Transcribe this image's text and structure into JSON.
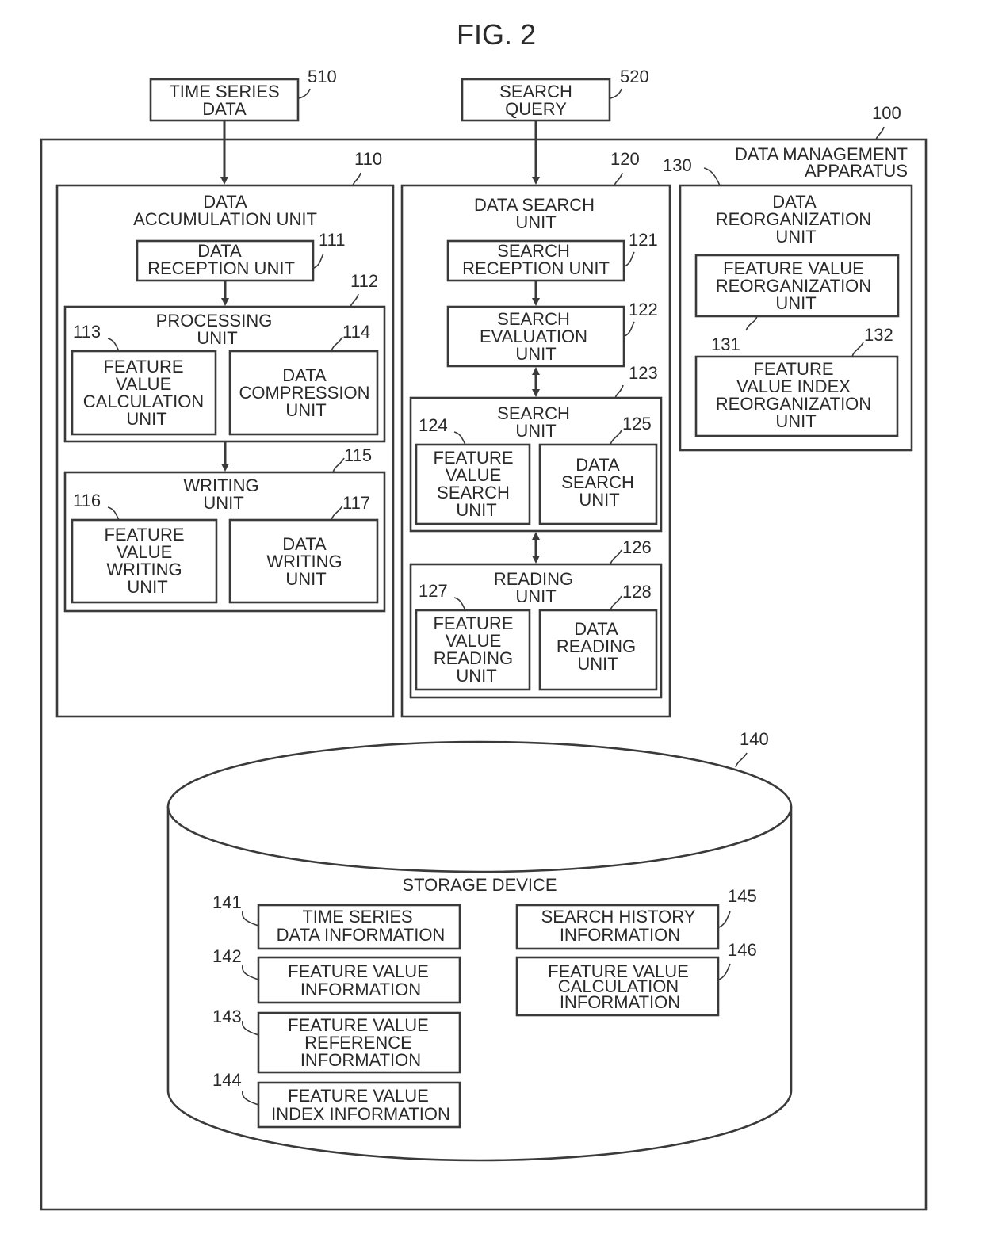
{
  "figure": {
    "title": "FIG. 2"
  },
  "inputs": [
    {
      "ref": "510",
      "lines": [
        "TIME SERIES",
        "DATA"
      ]
    },
    {
      "ref": "520",
      "lines": [
        "SEARCH",
        "QUERY"
      ]
    }
  ],
  "apparatus": {
    "ref": "100",
    "lines": [
      "DATA MANAGEMENT",
      "APPARATUS"
    ]
  },
  "accumulation": {
    "ref": "110",
    "lines": [
      "DATA",
      "ACCUMULATION UNIT"
    ],
    "reception": {
      "ref": "111",
      "lines": [
        "DATA",
        "RECEPTION UNIT"
      ]
    },
    "processing": {
      "ref": "112",
      "lines": [
        "PROCESSING",
        "UNIT"
      ],
      "left": {
        "ref": "113",
        "lines": [
          "FEATURE",
          "VALUE",
          "CALCULATION",
          "UNIT"
        ]
      },
      "right": {
        "ref": "114",
        "lines": [
          "DATA",
          "COMPRESSION",
          "UNIT"
        ]
      }
    },
    "writing": {
      "ref": "115",
      "lines": [
        "WRITING",
        "UNIT"
      ],
      "left": {
        "ref": "116",
        "lines": [
          "FEATURE",
          "VALUE",
          "WRITING",
          "UNIT"
        ]
      },
      "right": {
        "ref": "117",
        "lines": [
          "DATA",
          "WRITING",
          "UNIT"
        ]
      }
    }
  },
  "search": {
    "ref": "120",
    "lines": [
      "DATA SEARCH",
      "UNIT"
    ],
    "reception": {
      "ref": "121",
      "lines": [
        "SEARCH",
        "RECEPTION UNIT"
      ]
    },
    "evaluation": {
      "ref": "122",
      "lines": [
        "SEARCH",
        "EVALUATION",
        "UNIT"
      ]
    },
    "search_unit": {
      "ref": "123",
      "lines": [
        "SEARCH",
        "UNIT"
      ],
      "left": {
        "ref": "124",
        "lines": [
          "FEATURE",
          "VALUE",
          "SEARCH",
          "UNIT"
        ]
      },
      "right": {
        "ref": "125",
        "lines": [
          "DATA",
          "SEARCH",
          "UNIT"
        ]
      }
    },
    "reading": {
      "ref": "126",
      "lines": [
        "READING",
        "UNIT"
      ],
      "left": {
        "ref": "127",
        "lines": [
          "FEATURE",
          "VALUE",
          "READING",
          "UNIT"
        ]
      },
      "right": {
        "ref": "128",
        "lines": [
          "DATA",
          "READING",
          "UNIT"
        ]
      }
    }
  },
  "reorganization": {
    "ref": "130",
    "lines": [
      "DATA",
      "REORGANIZATION",
      "UNIT"
    ],
    "feature": {
      "ref": "131",
      "lines": [
        "FEATURE VALUE",
        "REORGANIZATION",
        "UNIT"
      ]
    },
    "index": {
      "ref": "132",
      "lines": [
        "FEATURE",
        "VALUE INDEX",
        "REORGANIZATION",
        "UNIT"
      ]
    }
  },
  "storage": {
    "ref": "140",
    "label": "STORAGE DEVICE",
    "items": [
      {
        "ref": "141",
        "lines": [
          "TIME SERIES",
          "DATA INFORMATION"
        ]
      },
      {
        "ref": "142",
        "lines": [
          "FEATURE VALUE",
          "INFORMATION"
        ]
      },
      {
        "ref": "143",
        "lines": [
          "FEATURE VALUE",
          "REFERENCE",
          "INFORMATION"
        ]
      },
      {
        "ref": "144",
        "lines": [
          "FEATURE VALUE",
          "INDEX INFORMATION"
        ]
      },
      {
        "ref": "145",
        "lines": [
          "SEARCH HISTORY",
          "INFORMATION"
        ]
      },
      {
        "ref": "146",
        "lines": [
          "FEATURE VALUE",
          "CALCULATION",
          "INFORMATION"
        ]
      }
    ]
  }
}
